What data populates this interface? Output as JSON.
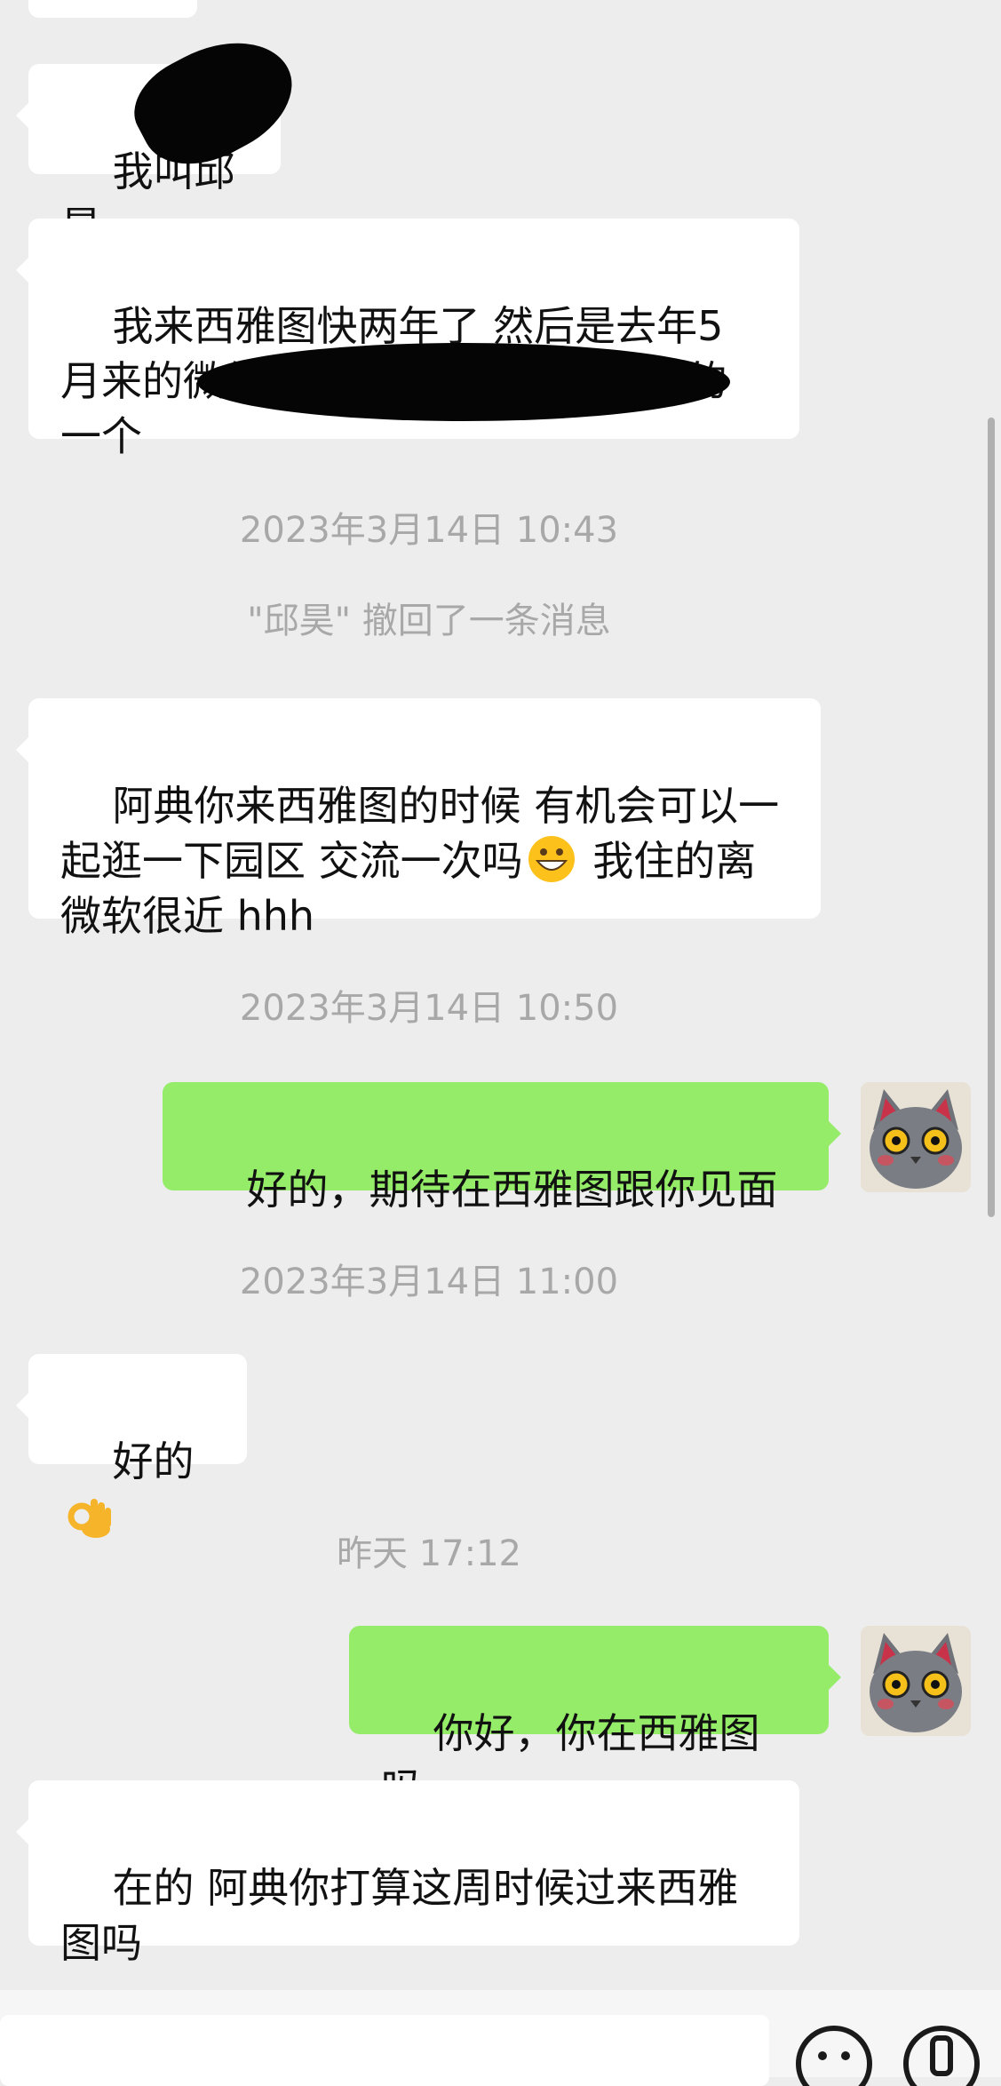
{
  "messages": {
    "m1": "我叫邱昊",
    "m2": "我来西雅图快两年了 然后是去年5月来的微软 现在在微软云计算下面的一个",
    "ts1": "2023年3月14日 10:43",
    "recall": "\"邱昊\" 撤回了一条消息",
    "m3a": "阿典你来西雅图的时候 有机会可以一起逛一下园区 交流一次吗",
    "m3b": " 我住的离微软很近 hhh",
    "ts2": "2023年3月14日 10:50",
    "m4": "好的，期待在西雅图跟你见面",
    "ts3": "2023年3月14日 11:00",
    "m5": "好的",
    "ts4": "昨天 17:12",
    "m6": "你好，你在西雅图吗",
    "m7": "在的 阿典你打算这周时候过来西雅图吗"
  },
  "icons": {
    "grin": "grinning-face-emoji",
    "ok": "ok-hand-emoji",
    "avatar": "cat-avatar",
    "voice": "emoji-face-icon",
    "plus": "plus-icon"
  },
  "colors": {
    "bg": "#ededed",
    "incoming": "#ffffff",
    "outgoing": "#95ec69",
    "timestamp": "#a8a8a8"
  }
}
